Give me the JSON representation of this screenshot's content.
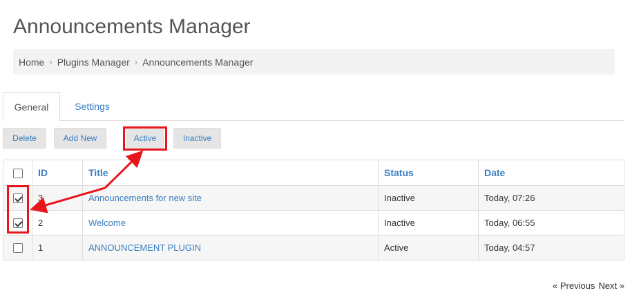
{
  "page_title": "Announcements Manager",
  "breadcrumb": {
    "items": [
      "Home",
      "Plugins Manager",
      "Announcements Manager"
    ],
    "separator": "›"
  },
  "tabs": [
    {
      "label": "General",
      "active": true
    },
    {
      "label": "Settings",
      "active": false
    }
  ],
  "toolbar": {
    "delete_label": "Delete",
    "add_new_label": "Add New",
    "active_label": "Active",
    "inactive_label": "Inactive"
  },
  "table": {
    "columns": [
      "ID",
      "Title",
      "Status",
      "Date"
    ],
    "rows": [
      {
        "checked": true,
        "id": "3",
        "title": "Announcements for new site",
        "status": "Inactive",
        "date": "Today, 07:26"
      },
      {
        "checked": true,
        "id": "2",
        "title": "Welcome",
        "status": "Inactive",
        "date": "Today, 06:55"
      },
      {
        "checked": false,
        "id": "1",
        "title": "ANNOUNCEMENT PLUGIN",
        "status": "Active",
        "date": "Today, 04:57"
      }
    ]
  },
  "pagination": {
    "previous_label": "« Previous",
    "next_label": "Next »"
  },
  "colors": {
    "link": "#3a7dc1",
    "annotation": "#e8161b",
    "button_bg": "#e5e5e5"
  }
}
